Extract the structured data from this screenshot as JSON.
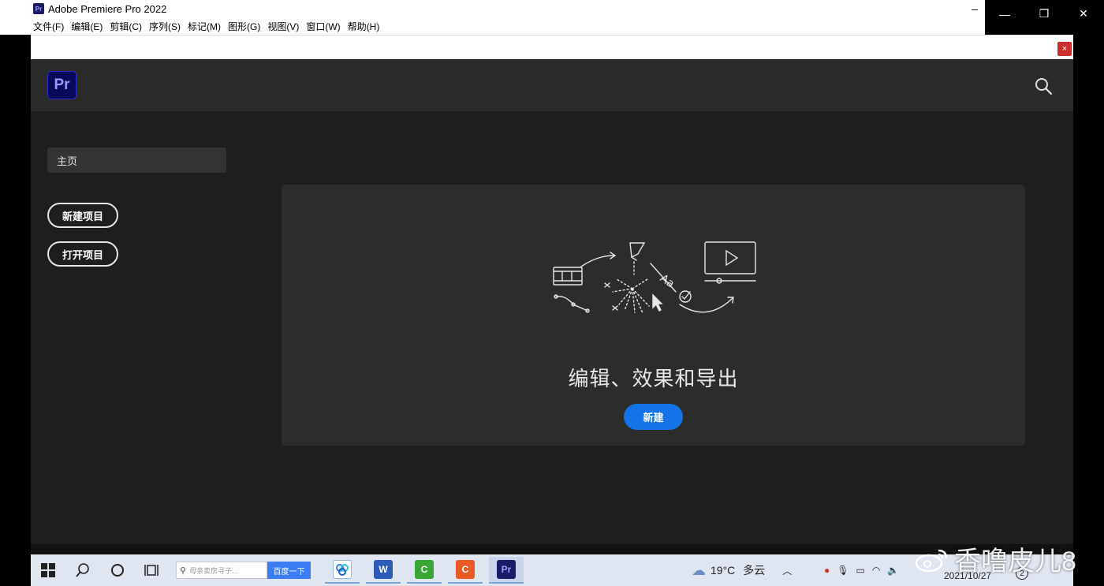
{
  "window": {
    "title": "Adobe Premiere Pro 2022",
    "app_icon_text": "Pr",
    "min_glyph": "–",
    "controls": {
      "minimize": "—",
      "restore": "❐",
      "close": "✕"
    }
  },
  "menubar": {
    "items": [
      "文件(F)",
      "编辑(E)",
      "剪辑(C)",
      "序列(S)",
      "标记(M)",
      "图形(G)",
      "视图(V)",
      "窗口(W)",
      "帮助(H)"
    ]
  },
  "notice_strip": {
    "close_glyph": "×"
  },
  "header": {
    "logo": "Pr",
    "search_icon": "search-icon"
  },
  "sidebar": {
    "home": "主页",
    "new_project": "新建项目",
    "open_project": "打开项目"
  },
  "card": {
    "heading": "编辑、效果和导出",
    "new_button": "新建"
  },
  "taskbar": {
    "search_placeholder": "母亲卖房寻子...",
    "search_button": "百度一下",
    "weather_temp": "19°C",
    "weather_desc": "多云",
    "date": "2021/10/27",
    "notification_count": "2"
  },
  "watermark": {
    "text": "香噜皮儿8"
  },
  "colors": {
    "accent": "#1473e6",
    "app_bg": "#1e1e1e",
    "card_bg": "#2c2c2c",
    "header_bg": "#2b2b2b"
  }
}
